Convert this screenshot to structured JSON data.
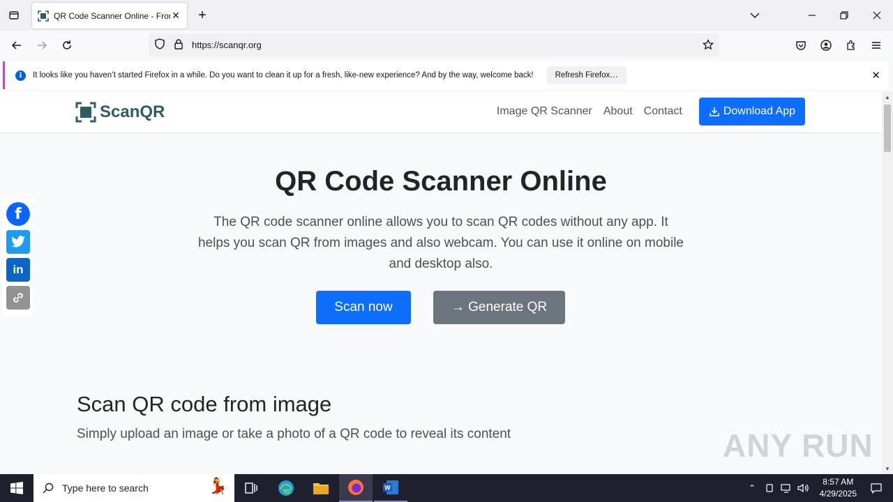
{
  "browser": {
    "tab_title": "QR Code Scanner Online - From",
    "url": "https://scanqr.org",
    "notification_text": "It looks like you haven’t started Firefox in a while. Do you want to clean it up for a fresh, like-new experience? And by the way, welcome back!",
    "notification_button": "Refresh Firefox…"
  },
  "site": {
    "logo_text": "ScanQR",
    "nav": [
      "Image QR Scanner",
      "About",
      "Contact"
    ],
    "download_label": "Download App",
    "hero_title": "QR Code Scanner Online",
    "hero_text": "The QR code scanner online allows you to scan QR codes without any app. It helps you scan QR from images and also webcam. You can use it online on mobile and desktop also.",
    "scan_button": "Scan now",
    "generate_button": "→ Generate QR",
    "section_title": "Scan QR code from image",
    "section_subtitle": "Simply upload an image or take a photo of a QR code to reveal its content",
    "brand_color": "#0d6efd",
    "secondary_color": "#6c757d"
  },
  "social": [
    {
      "name": "facebook",
      "color": "#0866ff",
      "glyph": "f"
    },
    {
      "name": "twitter",
      "color": "#1d9bf0",
      "glyph": "t"
    },
    {
      "name": "linkedin",
      "color": "#0a66c2",
      "glyph": "in"
    },
    {
      "name": "copy-link",
      "color": "#929292",
      "glyph": "∞"
    }
  ],
  "watermark": "ANY RUN",
  "taskbar": {
    "search_placeholder": "Type here to search",
    "time": "8:57 AM",
    "date": "4/29/2025"
  }
}
